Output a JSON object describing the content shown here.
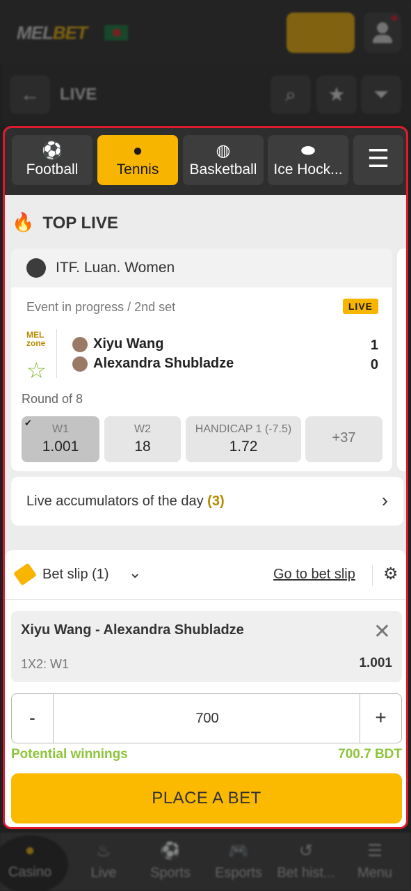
{
  "header": {
    "logo_part1": "MEL",
    "logo_part2": "BET"
  },
  "subheader": {
    "back_icon": "arrow-left-icon",
    "title": "LIVE",
    "actions": [
      "search-icon",
      "star-icon",
      "filter-icon"
    ]
  },
  "sport_tabs": [
    {
      "label": "Football",
      "icon": "soccer-ball-icon",
      "active": false
    },
    {
      "label": "Tennis",
      "icon": "tennis-ball-icon",
      "active": true
    },
    {
      "label": "Basketball",
      "icon": "basketball-icon",
      "active": false
    },
    {
      "label": "Ice Hock...",
      "icon": "hockey-puck-icon",
      "active": false
    },
    {
      "label": "",
      "icon": "menu-list-icon",
      "active": false
    }
  ],
  "top_live": {
    "title": "TOP LIVE"
  },
  "event": {
    "league": "ITF. Luan. Women",
    "status": "Event in progress / 2nd set",
    "live_badge": "LIVE",
    "zone_label_1": "MEL",
    "zone_label_2": "zone",
    "team1": "Xiyu Wang",
    "team2": "Alexandra Shubladze",
    "score1": "1",
    "score2": "0",
    "round": "Round of 8",
    "odds": [
      {
        "label": "W1",
        "value": "1.001",
        "selected": true
      },
      {
        "label": "W2",
        "value": "18",
        "selected": false
      },
      {
        "label": "HANDICAP 1 (-7.5)",
        "value": "1.72",
        "selected": false
      }
    ],
    "more_markets": "+37"
  },
  "accumulators": {
    "text": "Live accumulators of the day",
    "count": "(3)"
  },
  "bet_slip": {
    "title": "Bet slip (1)",
    "go_to": "Go to bet slip",
    "pick_teams": "Xiyu Wang - Alexandra Shubladze",
    "pick_market": "1X2: W1",
    "pick_odd": "1.001",
    "minus": "-",
    "stake": "700",
    "plus": "+",
    "potential_label": "Potential winnings",
    "potential_value": "700.7 BDT",
    "place_button": "PLACE A BET"
  },
  "bottom_nav": [
    "Casino",
    "Live",
    "Sports",
    "Esports",
    "Bet hist...",
    "Menu"
  ],
  "colors": {
    "accent": "#f7b500",
    "highlight_border": "#e0192d",
    "winnings": "#8dc43a"
  }
}
